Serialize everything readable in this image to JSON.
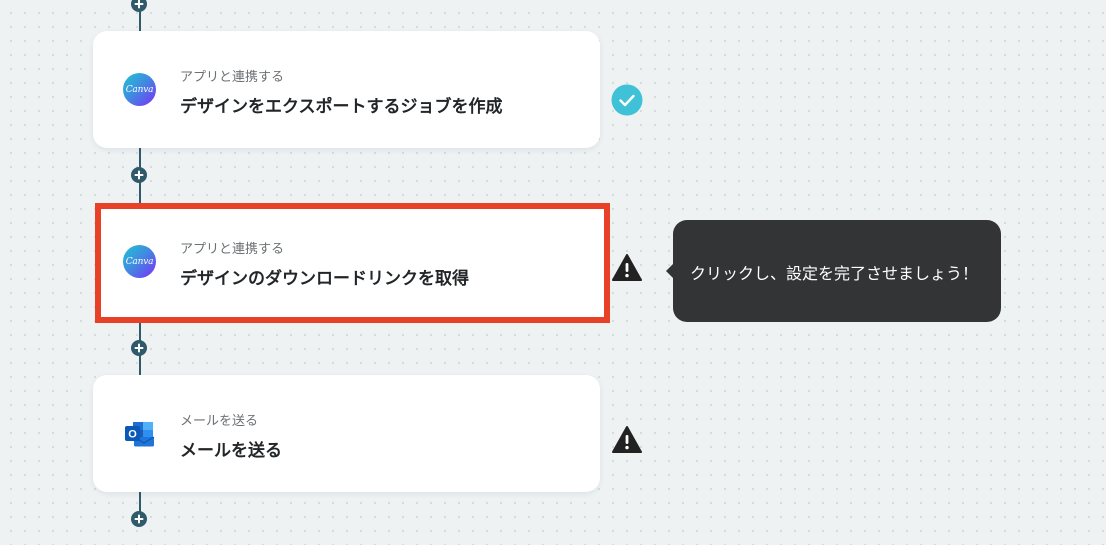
{
  "steps": [
    {
      "subtitle": "アプリと連携する",
      "title": "デザインをエクスポートするジョブを作成",
      "app_icon": "canva-logo",
      "status": "complete",
      "highlighted": false
    },
    {
      "subtitle": "アプリと連携する",
      "title": "デザインのダウンロードリンクを取得",
      "app_icon": "canva-logo",
      "status": "warning",
      "highlighted": true
    },
    {
      "subtitle": "メールを送る",
      "title": "メールを送る",
      "app_icon": "outlook-logo",
      "status": "warning",
      "highlighted": false
    }
  ],
  "canva_logo_text": "Canva",
  "outlook_logo_letter": "O",
  "tooltip": {
    "text": "クリックし、設定を完了させましょう！"
  },
  "colors": {
    "flow_line": "#2f5a6a",
    "highlight_border": "#e84128",
    "complete_check": "#3fc1d8",
    "warning": "#222222",
    "tooltip_bg": "#333436"
  }
}
